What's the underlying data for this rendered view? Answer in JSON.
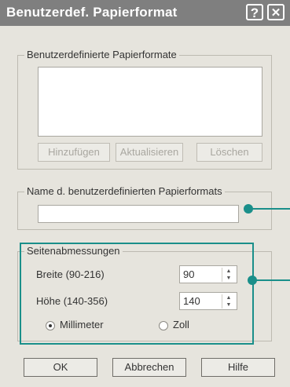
{
  "dialog": {
    "title": "Benutzerdef. Papierformat",
    "help_glyph": "?",
    "close_glyph": "✕"
  },
  "custom_formats": {
    "legend": "Benutzerdefinierte Papierformate",
    "add_label": "Hinzufügen",
    "update_label": "Aktualisieren",
    "delete_label": "Löschen"
  },
  "format_name": {
    "legend": "Name d. benutzerdefinierten Papierformats",
    "value": ""
  },
  "page_size": {
    "legend": "Seitenabmessungen",
    "width_label": "Breite (90-216)",
    "width_value": "90",
    "height_label": "Höhe (140-356)",
    "height_value": "140",
    "unit_mm_label": "Millimeter",
    "unit_inch_label": "Zoll",
    "selected_unit": "Millimeter"
  },
  "footer": {
    "ok_label": "OK",
    "cancel_label": "Abbrechen",
    "help_label": "Hilfe"
  },
  "colors": {
    "titlebar": "#7f7f7f",
    "dialog_bg": "#e6e4dd",
    "callout": "#1a8f8a"
  }
}
